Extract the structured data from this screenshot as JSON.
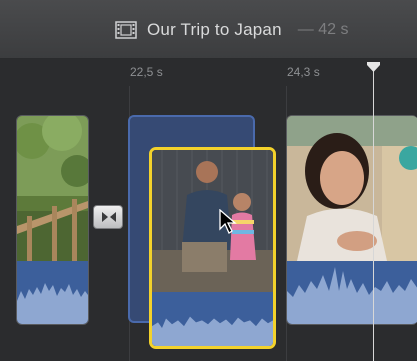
{
  "project": {
    "title": "Our Trip to Japan",
    "duration": "— 42 s"
  },
  "ruler": {
    "ticks": [
      "22,5 s",
      "24,3 s"
    ]
  },
  "icons": {
    "film": "film-icon",
    "transition": "transition-icon",
    "playhead": "playhead-icon",
    "cursor": "pointer-icon"
  },
  "colors": {
    "selection": "#f3d22b",
    "audio": "#3c5f9b",
    "drop_target": "#364a74"
  }
}
